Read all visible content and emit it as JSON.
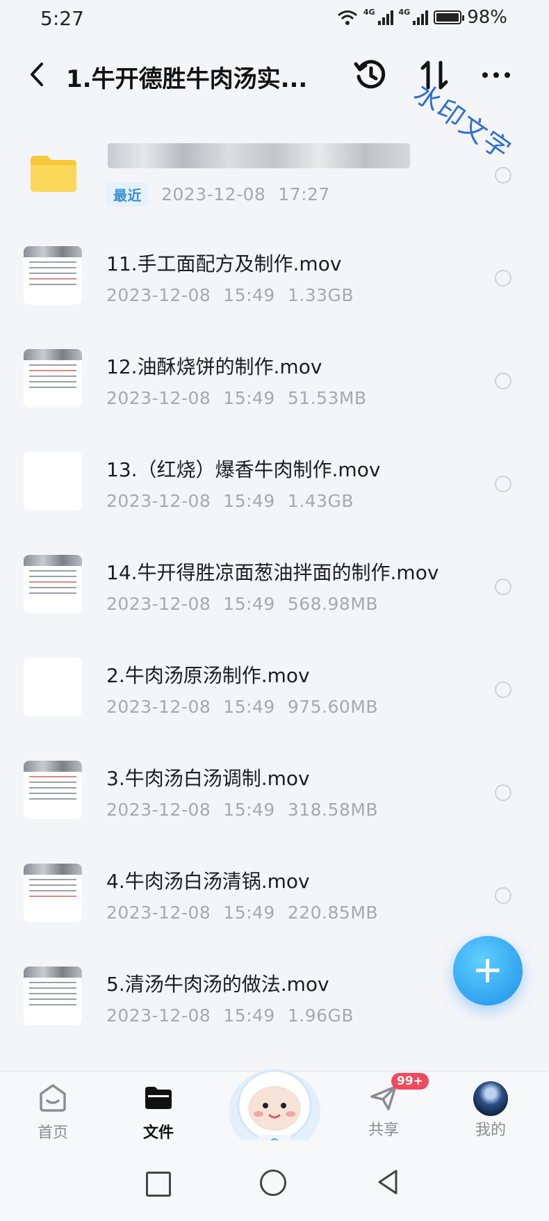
{
  "status": {
    "time": "5:27",
    "net1": "4G",
    "net2": "4G",
    "battery": "98%"
  },
  "header": {
    "title": "1.牛开德胜牛肉汤实...",
    "watermark": "水印文字"
  },
  "folder": {
    "tag": "最近",
    "date": "2023-12-08",
    "time": "17:27"
  },
  "files": [
    {
      "name": "11.手工面配方及制作.mov",
      "date": "2023-12-08",
      "time": "15:49",
      "size": "1.33GB"
    },
    {
      "name": "12.油酥烧饼的制作.mov",
      "date": "2023-12-08",
      "time": "15:49",
      "size": "51.53MB"
    },
    {
      "name": "13.（红烧）爆香牛肉制作.mov",
      "date": "2023-12-08",
      "time": "15:49",
      "size": "1.43GB"
    },
    {
      "name": "14.牛开得胜凉面葱油拌面的制作.mov",
      "date": "2023-12-08",
      "time": "15:49",
      "size": "568.98MB"
    },
    {
      "name": "2.牛肉汤原汤制作.mov",
      "date": "2023-12-08",
      "time": "15:49",
      "size": "975.60MB"
    },
    {
      "name": "3.牛肉汤白汤调制.mov",
      "date": "2023-12-08",
      "time": "15:49",
      "size": "318.58MB"
    },
    {
      "name": "4.牛肉汤白汤清锅.mov",
      "date": "2023-12-08",
      "time": "15:49",
      "size": "220.85MB"
    },
    {
      "name": "5.清汤牛肉汤的做法.mov",
      "date": "2023-12-08",
      "time": "15:49",
      "size": "1.96GB"
    }
  ],
  "nav": {
    "home": "首页",
    "files": "文件",
    "share": "共享",
    "share_badge": "99+",
    "me": "我的"
  },
  "colors": {
    "accent": "#1e8fe9",
    "badge": "#f14a5c",
    "folder": "#f7c83a"
  }
}
